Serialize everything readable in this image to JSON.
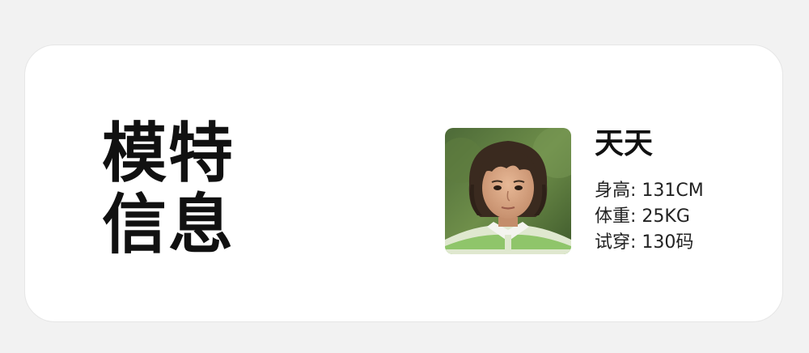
{
  "section": {
    "title_line1": "模特",
    "title_line2": "信息"
  },
  "model": {
    "name": "天天",
    "height": "身高: 131CM",
    "weight": "体重: 25KG",
    "size": "试穿: 130码"
  },
  "colors": {
    "page_background": "#f2f2f2",
    "card_background": "#ffffff",
    "text": "#111111",
    "shirt_green": "#8fc56a"
  },
  "icons": {
    "photo": "model-portrait-photo"
  }
}
